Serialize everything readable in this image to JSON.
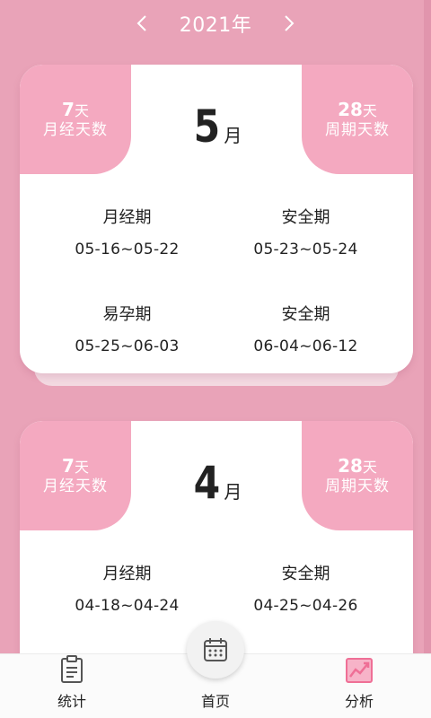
{
  "header": {
    "prev_icon": "chevron-left-icon",
    "year_label": "2021年",
    "next_icon": "chevron-right-icon"
  },
  "cards": [
    {
      "period_days": "7",
      "period_unit": "天",
      "period_caption": "月经天数",
      "cycle_days": "28",
      "cycle_unit": "天",
      "cycle_caption": "周期天数",
      "month_number": "5",
      "month_unit": "月",
      "phases": [
        {
          "label": "月经期",
          "range": "05-16~05-22"
        },
        {
          "label": "安全期",
          "range": "05-23~05-24"
        },
        {
          "label": "易孕期",
          "range": "05-25~06-03"
        },
        {
          "label": "安全期",
          "range": "06-04~06-12"
        }
      ]
    },
    {
      "period_days": "7",
      "period_unit": "天",
      "period_caption": "月经天数",
      "cycle_days": "28",
      "cycle_unit": "天",
      "cycle_caption": "周期天数",
      "month_number": "4",
      "month_unit": "月",
      "phases": [
        {
          "label": "月经期",
          "range": "04-18~04-24"
        },
        {
          "label": "安全期",
          "range": "04-25~04-26"
        }
      ]
    }
  ],
  "tabbar": {
    "stats_label": "统计",
    "home_label": "首页",
    "analysis_label": "分析"
  },
  "colors": {
    "background": "#e9a3b8",
    "accent": "#f4a9c0",
    "active_tab_icon": "#ef6f96"
  }
}
